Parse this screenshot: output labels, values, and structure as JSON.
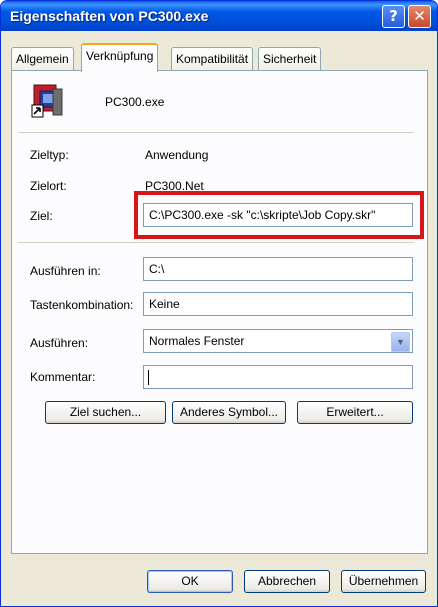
{
  "window": {
    "title": "Eigenschaften von PC300.exe",
    "help": "?",
    "close": "✕"
  },
  "tabs": [
    "Allgemein",
    "Verknüpfung",
    "Kompatibilität",
    "Sicherheit"
  ],
  "shortcut": {
    "name": "PC300.exe"
  },
  "fields": {
    "zieltyp_label": "Zieltyp:",
    "zieltyp_value": "Anwendung",
    "zielort_label": "Zielort:",
    "zielort_value": "PC300.Net",
    "ziel_label": "Ziel:",
    "ziel_value": "C:\\PC300.exe -sk \"c:\\skripte\\Job Copy.skr\"",
    "ausfuehren_in_label": "Ausführen in:",
    "ausfuehren_in_value": "C:\\",
    "tasten_label": "Tastenkombination:",
    "tasten_value": "Keine",
    "ausfuehren_label": "Ausführen:",
    "ausfuehren_value": "Normales Fenster",
    "kommentar_label": "Kommentar:",
    "kommentar_value": ""
  },
  "buttons": {
    "ziel_suchen": "Ziel suchen...",
    "anderes_symbol": "Anderes Symbol...",
    "erweitert": "Erweitert...",
    "ok": "OK",
    "abbrechen": "Abbrechen",
    "uebernehmen": "Übernehmen"
  },
  "colors": {
    "highlight_box": "#D5171C",
    "titlebar": "#0058E6"
  }
}
